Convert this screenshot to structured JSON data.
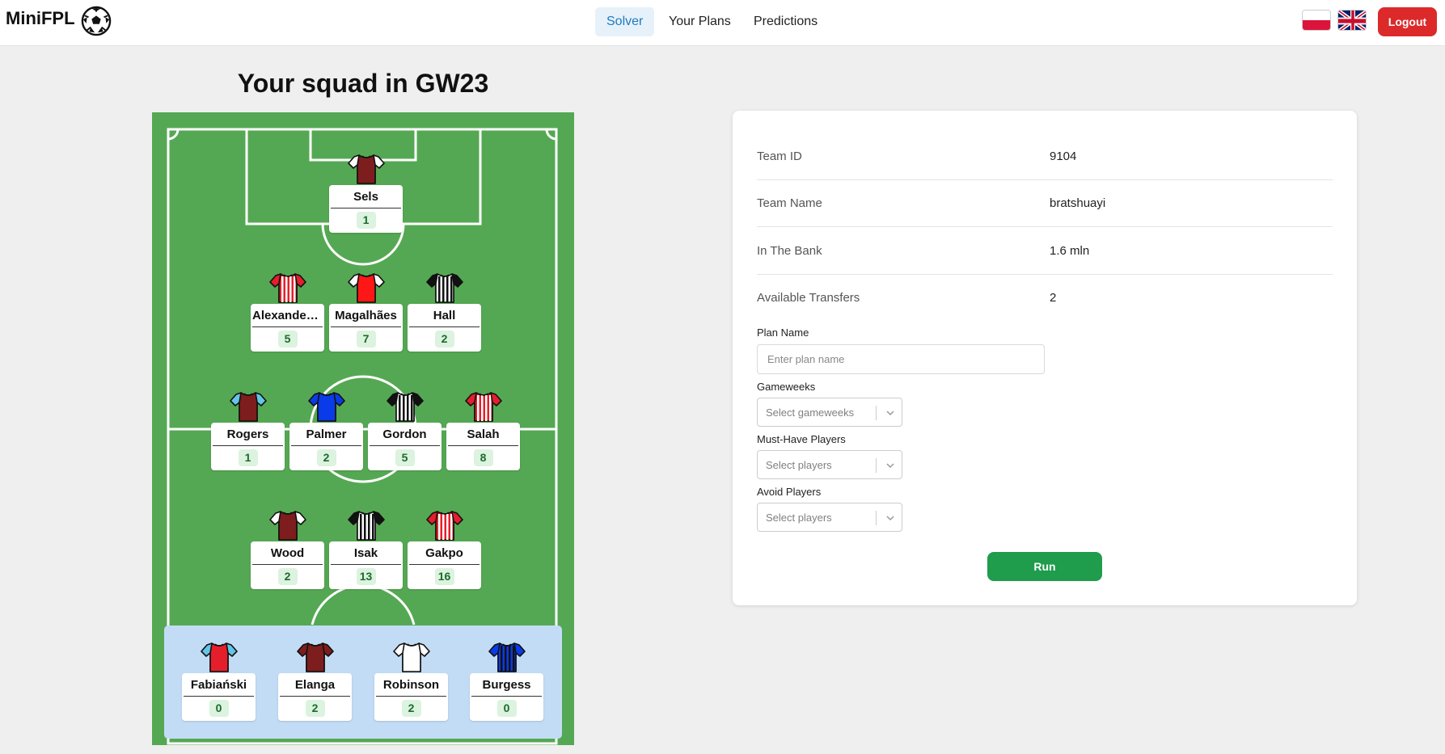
{
  "app": {
    "brand": "MiniFPL",
    "logo_icon": "soccer-ball-icon"
  },
  "nav": {
    "items": [
      {
        "label": "Solver",
        "active": true
      },
      {
        "label": "Your Plans",
        "active": false
      },
      {
        "label": "Predictions",
        "active": false
      }
    ]
  },
  "languages": [
    "polish-flag-icon",
    "uk-flag-icon"
  ],
  "logout_label": "Logout",
  "squad": {
    "title": "Your squad in GW23",
    "goalkeeper": [
      {
        "name": "Sels",
        "points": "1",
        "shirt": {
          "base": "#7d1d1d",
          "stripe": "#7d1d1d",
          "sleeve": "#ffffff"
        }
      }
    ],
    "defenders": [
      {
        "name": "Alexander-...",
        "points": "5",
        "shirt": {
          "base": "#e41f2b",
          "stripe": "#ffffff",
          "sleeve": "#e41f2b"
        }
      },
      {
        "name": "Magalhães",
        "points": "7",
        "shirt": {
          "base": "#ff1616",
          "stripe": "#ff1616",
          "sleeve": "#ffffff"
        }
      },
      {
        "name": "Hall",
        "points": "2",
        "shirt": {
          "base": "#ffffff",
          "stripe": "#111111",
          "sleeve": "#111111"
        }
      }
    ],
    "midfielders": [
      {
        "name": "Rogers",
        "points": "1",
        "shirt": {
          "base": "#7d1d1d",
          "stripe": "#7d1d1d",
          "sleeve": "#62c6e6"
        }
      },
      {
        "name": "Palmer",
        "points": "2",
        "shirt": {
          "base": "#0a3be8",
          "stripe": "#0a3be8",
          "sleeve": "#0a3be8"
        }
      },
      {
        "name": "Gordon",
        "points": "5",
        "shirt": {
          "base": "#ffffff",
          "stripe": "#111111",
          "sleeve": "#111111"
        }
      },
      {
        "name": "Salah",
        "points": "8",
        "shirt": {
          "base": "#e41f2b",
          "stripe": "#ffffff",
          "sleeve": "#e41f2b"
        }
      }
    ],
    "forwards": [
      {
        "name": "Wood",
        "points": "2",
        "shirt": {
          "base": "#7d1d1d",
          "stripe": "#7d1d1d",
          "sleeve": "#ffffff"
        }
      },
      {
        "name": "Isak",
        "points": "13",
        "shirt": {
          "base": "#ffffff",
          "stripe": "#111111",
          "sleeve": "#111111"
        }
      },
      {
        "name": "Gakpo",
        "points": "16",
        "shirt": {
          "base": "#e41f2b",
          "stripe": "#ffffff",
          "sleeve": "#e41f2b"
        }
      }
    ],
    "bench": [
      {
        "name": "Fabiański",
        "points": "0",
        "shirt": {
          "base": "#e41f2b",
          "stripe": "#e41f2b",
          "sleeve": "#62c6e6"
        }
      },
      {
        "name": "Elanga",
        "points": "2",
        "shirt": {
          "base": "#7d1d1d",
          "stripe": "#7d1d1d",
          "sleeve": "#7d1d1d"
        }
      },
      {
        "name": "Robinson",
        "points": "2",
        "shirt": {
          "base": "#ffffff",
          "stripe": "#ffffff",
          "sleeve": "#ffffff"
        }
      },
      {
        "name": "Burgess",
        "points": "0",
        "shirt": {
          "base": "#0a3be8",
          "stripe": "#111111",
          "sleeve": "#0a3be8"
        }
      }
    ]
  },
  "team_info": {
    "team_id_label": "Team ID",
    "team_id": "9104",
    "team_name_label": "Team Name",
    "team_name": "bratshuayi",
    "bank_label": "In The Bank",
    "bank": "1.6 mln",
    "transfers_label": "Available Transfers",
    "transfers": "2"
  },
  "form": {
    "plan_name_label": "Plan Name",
    "plan_name_placeholder": "Enter plan name",
    "gameweeks_label": "Gameweeks",
    "gameweeks_placeholder": "Select gameweeks",
    "must_have_label": "Must-Have Players",
    "must_have_placeholder": "Select players",
    "avoid_label": "Avoid Players",
    "avoid_placeholder": "Select players",
    "run_label": "Run"
  },
  "colors": {
    "pitch": "#55a853",
    "bench": "#c3dcf6",
    "accent": "#1f7bc1",
    "logout": "#dc2a2a",
    "run": "#1f9c4c",
    "points_bg": "#dcf3df"
  }
}
